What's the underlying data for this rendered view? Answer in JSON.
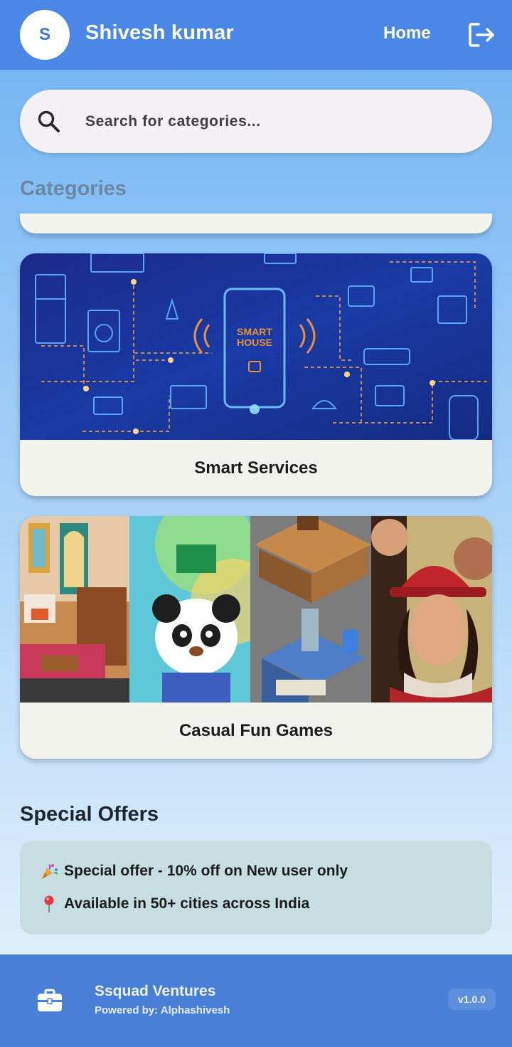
{
  "header": {
    "avatar_initial": "S",
    "username": "Shivesh kumar",
    "nav_home": "Home",
    "logout_icon": "logout-icon"
  },
  "search": {
    "placeholder": "Search for categories...",
    "icon": "search-icon"
  },
  "categories": {
    "title": "Categories",
    "items": [
      {
        "label": "Smart Services",
        "image": "smart-house-illustration"
      },
      {
        "label": "Casual Fun Games",
        "image": "casual-games-collage"
      }
    ]
  },
  "offers": {
    "title": "Special Offers",
    "lines": [
      {
        "icon": "party-popper-icon",
        "text": "Special offer - 10% off on New user only"
      },
      {
        "icon": "pin-icon",
        "text": "Available in 50+ cities across India"
      }
    ]
  },
  "footer": {
    "icon": "briefcase-icon",
    "company": "Ssquad Ventures",
    "powered_by": "Powered by: Alphashivesh",
    "version": "v1.0.0"
  },
  "colors": {
    "topbar": "#4a87e6",
    "footer": "#4a7fd8",
    "card": "#f1f3ec",
    "offers_box": "#c6dde2"
  }
}
